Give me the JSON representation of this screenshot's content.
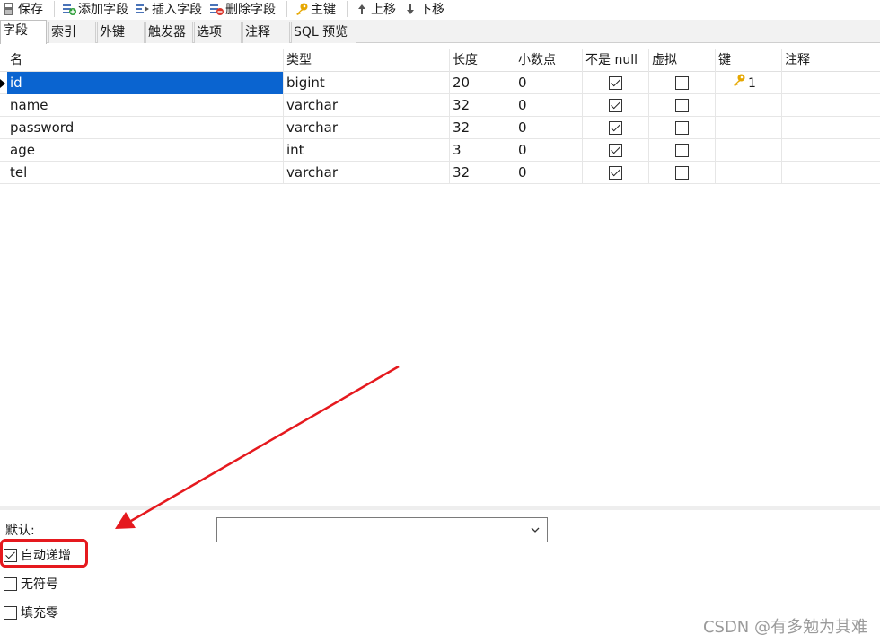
{
  "toolbar": {
    "save_label": "保存",
    "add_field_label": "添加字段",
    "insert_field_label": "插入字段",
    "delete_field_label": "删除字段",
    "primary_key_label": "主键",
    "move_up_label": "上移",
    "move_down_label": "下移"
  },
  "tabs": [
    "字段",
    "索引",
    "外键",
    "触发器",
    "选项",
    "注释",
    "SQL 预览"
  ],
  "active_tab": "字段",
  "grid": {
    "headers": [
      "名",
      "类型",
      "长度",
      "小数点",
      "不是 null",
      "虚拟",
      "键",
      "注释"
    ],
    "rows": [
      {
        "name": "id",
        "type": "bigint",
        "length": "20",
        "decimals": "0",
        "not_null": true,
        "virtual": false,
        "key": "1",
        "comment": ""
      },
      {
        "name": "name",
        "type": "varchar",
        "length": "32",
        "decimals": "0",
        "not_null": true,
        "virtual": false,
        "key": "",
        "comment": ""
      },
      {
        "name": "password",
        "type": "varchar",
        "length": "32",
        "decimals": "0",
        "not_null": true,
        "virtual": false,
        "key": "",
        "comment": ""
      },
      {
        "name": "age",
        "type": "int",
        "length": "3",
        "decimals": "0",
        "not_null": true,
        "virtual": false,
        "key": "",
        "comment": ""
      },
      {
        "name": "tel",
        "type": "varchar",
        "length": "32",
        "decimals": "0",
        "not_null": true,
        "virtual": false,
        "key": "",
        "comment": ""
      }
    ]
  },
  "bottom": {
    "default_label": "默认:",
    "default_value": "",
    "options": [
      {
        "label": "自动递增",
        "checked": true
      },
      {
        "label": "无符号",
        "checked": false
      },
      {
        "label": "填充零",
        "checked": false
      }
    ]
  },
  "annotation": {
    "color": "#e5191e"
  },
  "watermark": "CSDN @有多勉为其难",
  "colors": {
    "selection": "#0a64d0",
    "key_icon": "#e6a700"
  }
}
